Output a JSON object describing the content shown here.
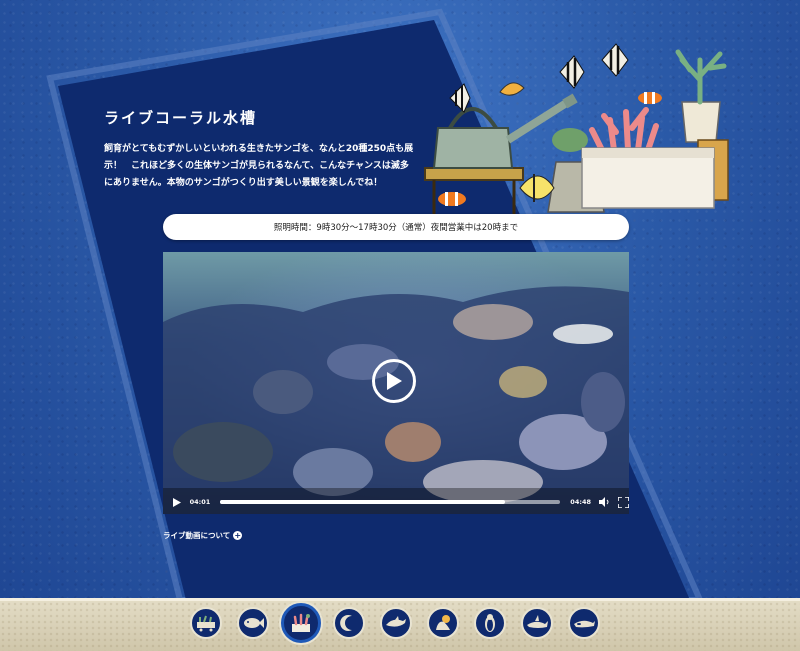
{
  "exhibit": {
    "title": "ライブコーラル水槽",
    "description": "飼育がとてもむずかしいといわれる生きたサンゴを、なんと20種250点も展示！　これほど多くの生体サンゴが見られるなんて、こんなチャンスは滅多にありません。本物のサンゴがつくり出す美しい景観を楽しんでね！",
    "hours": "照明時間：9時30分〜17時30分（通常）夜間営業中は20時まで"
  },
  "video": {
    "current_time": "04:01",
    "duration": "04:48",
    "progress": 0.836
  },
  "about_link": "ライブ動画について",
  "colors": {
    "panel": "#0e2a6e",
    "panel_border": "#5d82c2",
    "background": "#2b5aa8",
    "bottom_bar": "#d8d0b6",
    "nav_active": "#1f59b8"
  },
  "nav": {
    "items": [
      {
        "icon": "coral-cart-icon"
      },
      {
        "icon": "fish-icon"
      },
      {
        "icon": "coral-tank-icon",
        "active": true
      },
      {
        "icon": "jellyfish-icon"
      },
      {
        "icon": "dolphin-icon"
      },
      {
        "icon": "seal-icon"
      },
      {
        "icon": "penguin-icon"
      },
      {
        "icon": "shark-icon"
      },
      {
        "icon": "orca-icon"
      }
    ]
  }
}
